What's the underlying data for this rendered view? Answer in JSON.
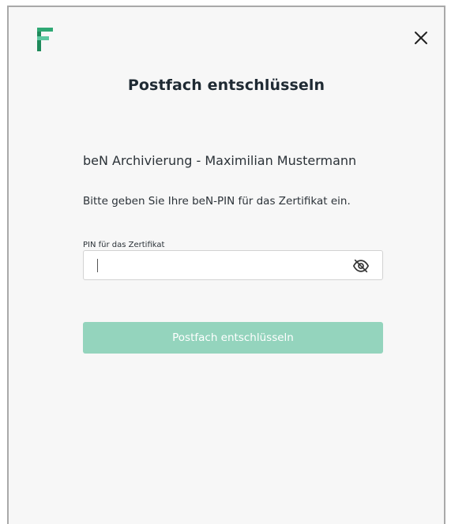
{
  "dialog": {
    "title": "Postfach entschlüsseln",
    "account_name": "beN Archivierung - Maximilian Mustermann",
    "instruction": "Bitte geben Sie Ihre beN-PIN für das Zertifikat ein.",
    "pin_field": {
      "label": "PIN für das Zertifikat",
      "value": "",
      "placeholder": ""
    },
    "submit_label": "Postfach entschlüsseln",
    "submit_enabled": false
  },
  "icons": {
    "logo": "brand-f-logo",
    "close": "close-icon",
    "visibility_toggle": "eye-slash-icon"
  },
  "colors": {
    "brand_green_dark": "#1f8a5b",
    "brand_green_light": "#5cc7a0",
    "button_disabled": "#94d4bd",
    "text_dark": "#1f2a33"
  }
}
